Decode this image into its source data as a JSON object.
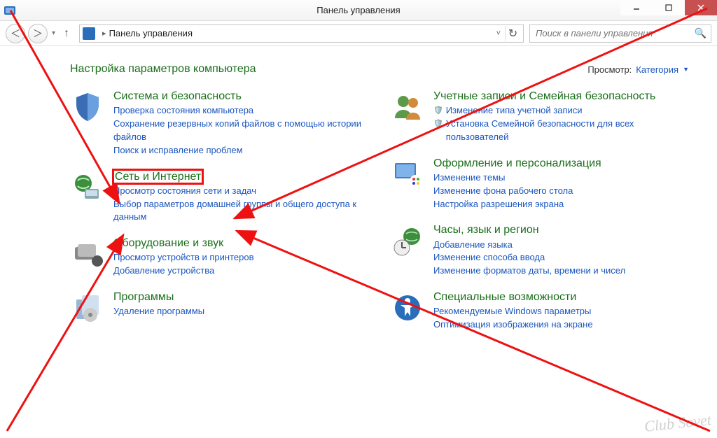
{
  "window": {
    "title": "Панель управления",
    "search_placeholder": "Поиск в панели управления"
  },
  "breadcrumb": {
    "root": "Панель управления"
  },
  "content": {
    "heading": "Настройка параметров компьютера",
    "view_label": "Просмотр:",
    "view_value": "Категория"
  },
  "left": [
    {
      "title": "Система и безопасность",
      "links": [
        "Проверка состояния компьютера",
        "Сохранение резервных копий файлов с помощью истории файлов",
        "Поиск и исправление проблем"
      ]
    },
    {
      "title": "Сеть и Интернет",
      "highlight": true,
      "links": [
        "Просмотр состояния сети и задач",
        "Выбор параметров домашней группы и общего доступа к данным"
      ]
    },
    {
      "title": "Оборудование и звук",
      "links": [
        "Просмотр устройств и принтеров",
        "Добавление устройства"
      ]
    },
    {
      "title": "Программы",
      "links": [
        "Удаление программы"
      ]
    }
  ],
  "right": [
    {
      "title": "Учетные записи и Семейная безопасность",
      "links": [
        {
          "text": "Изменение типа учетной записи",
          "shield": true
        },
        {
          "text": "Установка Семейной безопасности для всех пользователей",
          "shield": true
        }
      ]
    },
    {
      "title": "Оформление и персонализация",
      "links": [
        "Изменение темы",
        "Изменение фона рабочего стола",
        "Настройка разрешения экрана"
      ]
    },
    {
      "title": "Часы, язык и регион",
      "links": [
        "Добавление языка",
        "Изменение способа ввода",
        "Изменение форматов даты, времени и чисел"
      ]
    },
    {
      "title": "Специальные возможности",
      "links": [
        "Рекомендуемые Windows параметры",
        "Оптимизация изображения на экране"
      ]
    }
  ],
  "watermark": "Club Sovet"
}
